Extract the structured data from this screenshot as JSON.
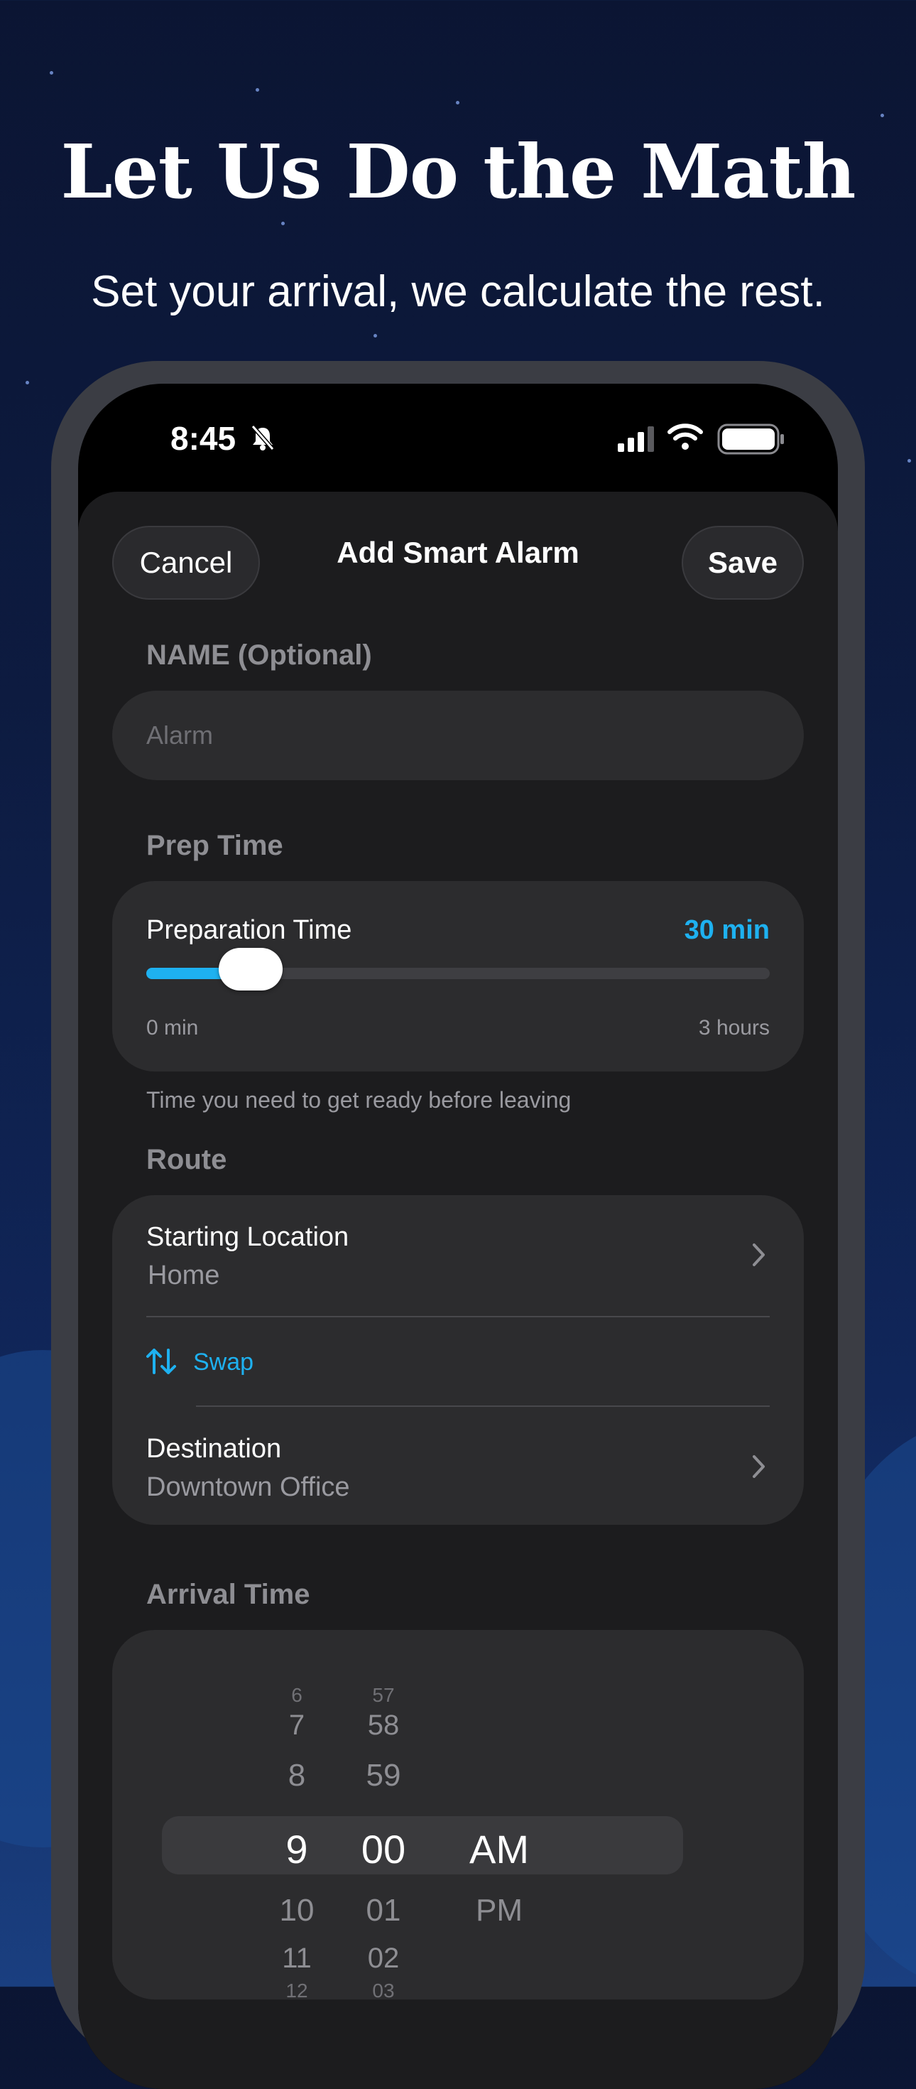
{
  "marketing": {
    "headline": "Let Us Do the Math",
    "subline": "Set your arrival, we calculate the rest."
  },
  "status_bar": {
    "time": "8:45",
    "icons": [
      "bell-slash-icon",
      "cellular-signal-icon",
      "wifi-icon",
      "battery-icon"
    ]
  },
  "nav": {
    "cancel_label": "Cancel",
    "title": "Add Smart Alarm",
    "save_label": "Save"
  },
  "name_section": {
    "label": "NAME (Optional)",
    "placeholder": "Alarm",
    "value": ""
  },
  "prep_section": {
    "label": "Prep Time",
    "title": "Preparation Time",
    "value_text": "30 min",
    "slider_fraction": 0.167,
    "min_label": "0 min",
    "max_label": "3 hours",
    "helper": "Time you need to get ready before leaving"
  },
  "route_section": {
    "label": "Route",
    "start_title": "Starting Location",
    "start_value": "Home",
    "swap_label": "Swap",
    "dest_title": "Destination",
    "dest_value": "Downtown Office"
  },
  "arrival_section": {
    "label": "Arrival Time",
    "hours_above": [
      "6",
      "7",
      "8"
    ],
    "hour_selected": "9",
    "hours_below": [
      "10",
      "11",
      "12"
    ],
    "minutes_above": [
      "57",
      "58",
      "59"
    ],
    "minute_selected": "00",
    "minutes_below": [
      "01",
      "02",
      "03"
    ],
    "period_selected": "AM",
    "period_below": "PM"
  },
  "colors": {
    "accent": "#1eb1f0",
    "sheet_bg": "#1c1c1e",
    "card_bg": "#2c2c2e"
  }
}
